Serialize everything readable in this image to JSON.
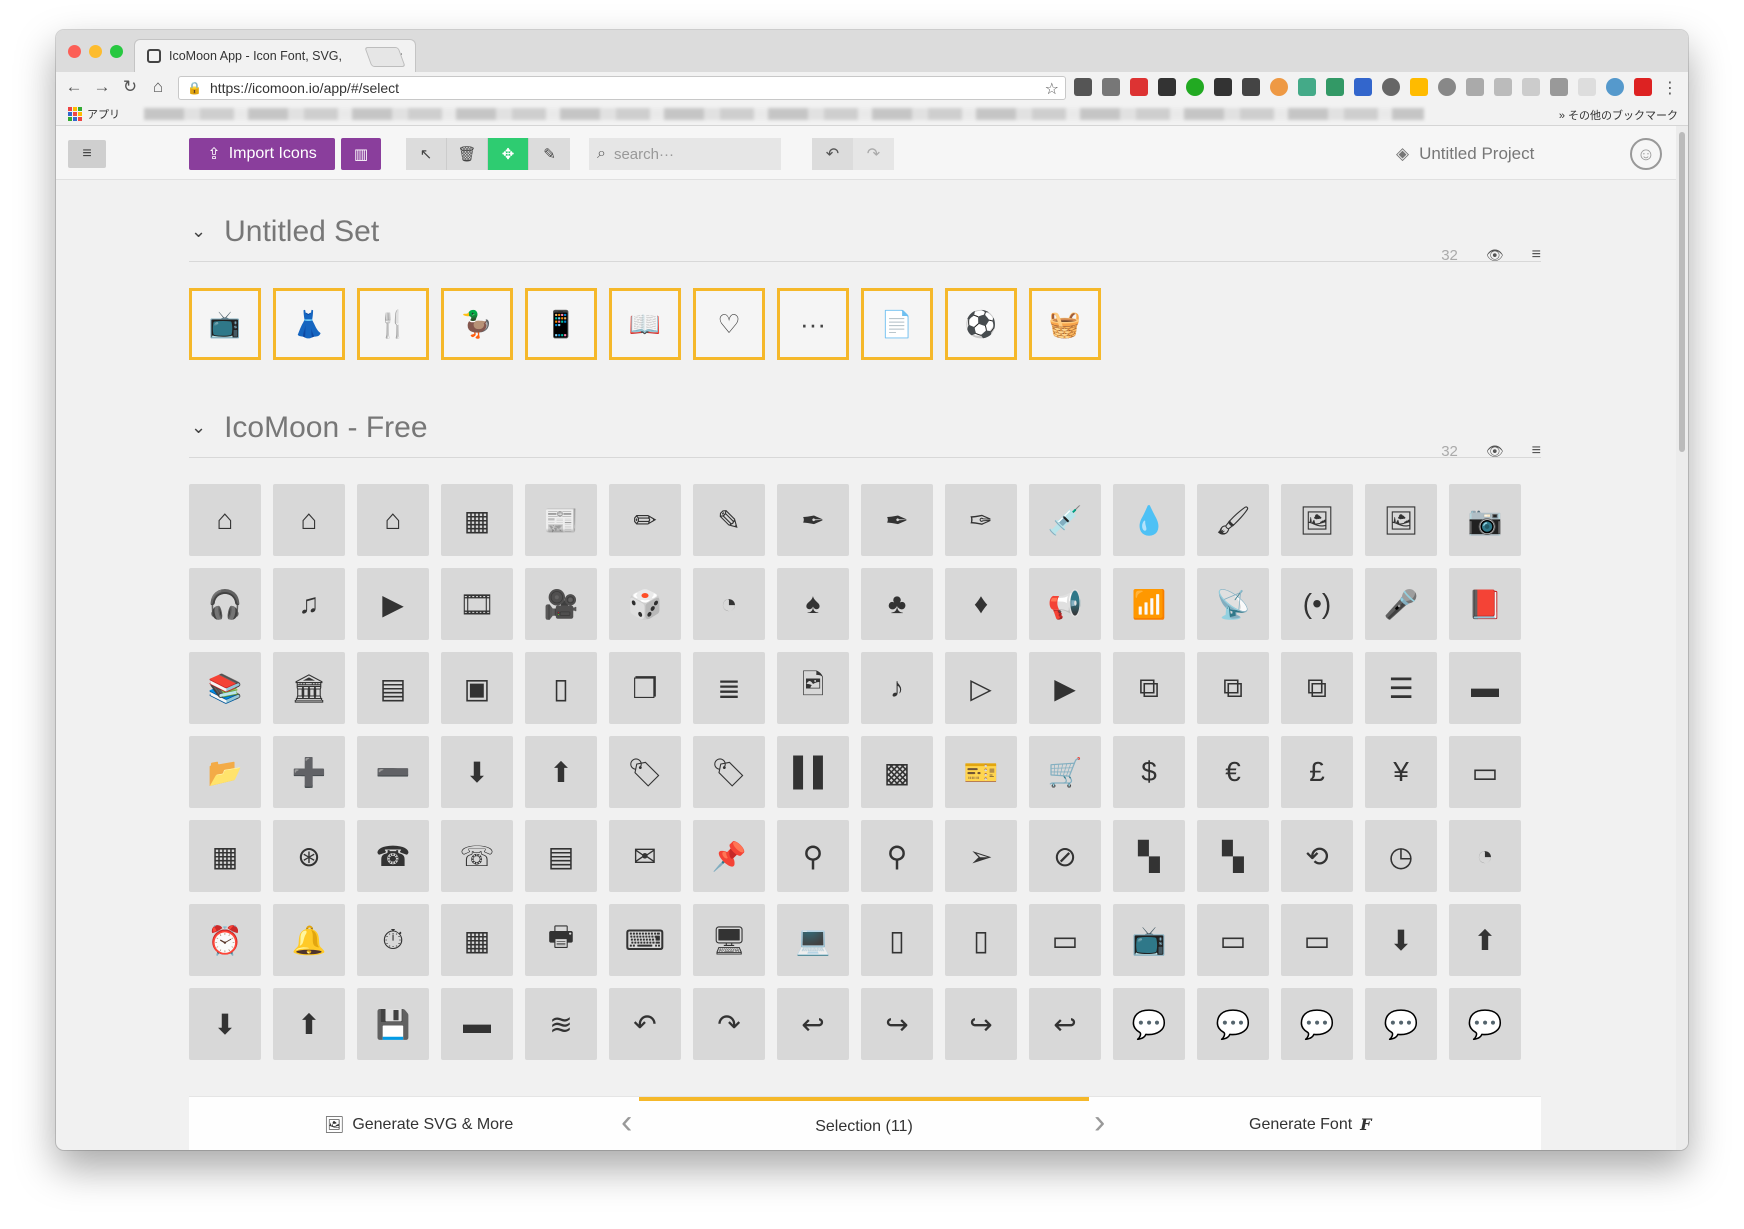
{
  "browser": {
    "tab_title": "IcoMoon App - Icon Font, SVG,",
    "tab_close": "×",
    "url": "https://icomoon.io/app/#/select",
    "apps_label": "アプリ",
    "other_bookmarks": "» その他のブックマーク"
  },
  "toolbar": {
    "menu_icon": "≡",
    "import_label": "Import Icons",
    "import_icon": "⇪",
    "library_icon": "▥",
    "tools": [
      {
        "name": "select-tool",
        "glyph": "↖"
      },
      {
        "name": "delete-tool",
        "glyph": "🗑"
      },
      {
        "name": "move-tool",
        "glyph": "✥"
      },
      {
        "name": "edit-tool",
        "glyph": "✎"
      }
    ],
    "search_placeholder": "search···",
    "search_icon": "⌕",
    "undo": "↶",
    "redo": "↷",
    "project_icon": "◈",
    "project_name": "Untitled Project",
    "smiley": "☺"
  },
  "sets": [
    {
      "title": "Untitled Set",
      "count": "32",
      "eye": "👁",
      "menu": "≡",
      "chevron": "⌄"
    },
    {
      "title": "IcoMoon - Free",
      "count": "32",
      "eye": "👁",
      "menu": "≡",
      "chevron": "⌄"
    }
  ],
  "selected_icons": [
    "📺",
    "👗",
    "🍴",
    "🦆",
    "📱",
    "📖",
    "♡",
    "···",
    "📄",
    "⚽",
    "🧺"
  ],
  "grid_icons": [
    "⌂",
    "⌂",
    "⌂",
    "▦",
    "📰",
    "✏",
    "✎",
    "✒",
    "✒",
    "✑",
    "💉",
    "💧",
    "🖌",
    "🖼",
    "🖼",
    "📷",
    "🎧",
    "♫",
    "▶",
    "🎞",
    "🎥",
    "🎲",
    "◔",
    "♠",
    "♣",
    "♦",
    "📢",
    "📶",
    "📡",
    "(•)",
    "🎤",
    "📕",
    "📚",
    "🏛",
    "▤",
    "▣",
    "▯",
    "❐",
    "≣",
    "🖻",
    "♪",
    "▷",
    "▶",
    "⧉",
    "⧉",
    "⧉",
    "☰",
    "▬",
    "📂",
    "➕",
    "➖",
    "⬇",
    "⬆",
    "🏷",
    "🏷",
    "▌▌",
    "▩",
    "🎫",
    "🛒",
    "$",
    "€",
    "£",
    "¥",
    "▭",
    "▦",
    "⊛",
    "☎",
    "☏",
    "▤",
    "✉",
    "📌",
    "⚲",
    "⚲",
    "➢",
    "⊘",
    "▚",
    "▚",
    "⟲",
    "◷",
    "◔",
    "⏰",
    "🔔",
    "⏱",
    "▦",
    "🖶",
    "⌨",
    "🖥",
    "💻",
    "▯",
    "▯",
    "▭",
    "📺",
    "▭",
    "▭",
    "⬇",
    "⬆",
    "⬇",
    "⬆",
    "💾",
    "▬",
    "≋",
    "↶",
    "↷",
    "↩",
    "↪",
    "↪",
    "↩",
    "💬",
    "💬",
    "💬",
    "💬",
    "💬"
  ],
  "footer": {
    "gen_svg_icon": "🖼",
    "gen_svg_label": "Generate SVG & More",
    "selection_label": "Selection (11)",
    "gen_font_label": "Generate Font",
    "gen_font_icon": "F",
    "prev": "‹",
    "next": "›"
  },
  "colors": {
    "accent_purple": "#8a3e9c",
    "selection_yellow": "#f5b82a",
    "move_tool_green": "#2ecc71"
  }
}
